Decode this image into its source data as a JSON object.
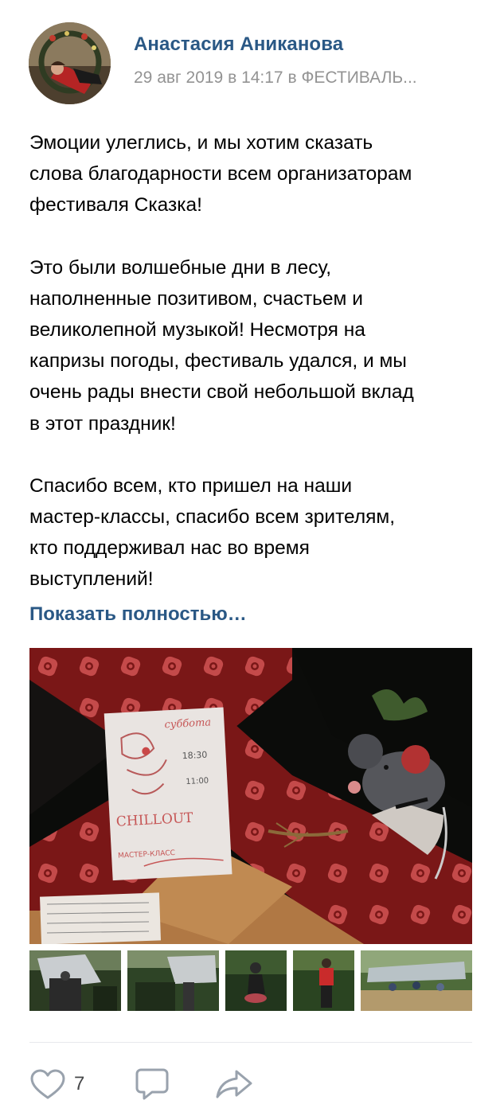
{
  "post": {
    "author": "Анастасия Аниканова",
    "meta": "29 авг 2019 в 14:17 в ФЕСТИВАЛЬ...",
    "paragraphs": [
      [
        "Эмоции улеглись, и мы хотим сказать",
        "слова благодарности всем организаторам",
        "фестиваля Сказка!"
      ],
      [
        "Это были волшебные дни в лесу,",
        "наполненные позитивом, счастьем и",
        "великолепной музыкой! Несмотря на",
        "капризы погоды, фестиваль удался, и мы",
        "очень рады внести свой небольшой вклад",
        "в этот праздник!"
      ],
      [
        "Спасибо всем, кто пришел на наши",
        "мастер-классы, спасибо всем зрителям,",
        "кто поддерживал нас во время",
        "выступлений!"
      ]
    ],
    "show_more": "Показать полностью…",
    "photo_note": {
      "line1": "суббота",
      "line2": "18:30",
      "line3": "11:00",
      "line4": "CHILLOUT",
      "line5": "МАСТЕР-КЛАСС"
    }
  },
  "actions": {
    "like_count": "7",
    "icons": [
      "heart-icon",
      "comment-icon",
      "share-icon"
    ]
  },
  "colors": {
    "link": "#2a5885",
    "meta": "#939393",
    "icon": "#99a2ad",
    "divider": "#e7e8ec"
  }
}
